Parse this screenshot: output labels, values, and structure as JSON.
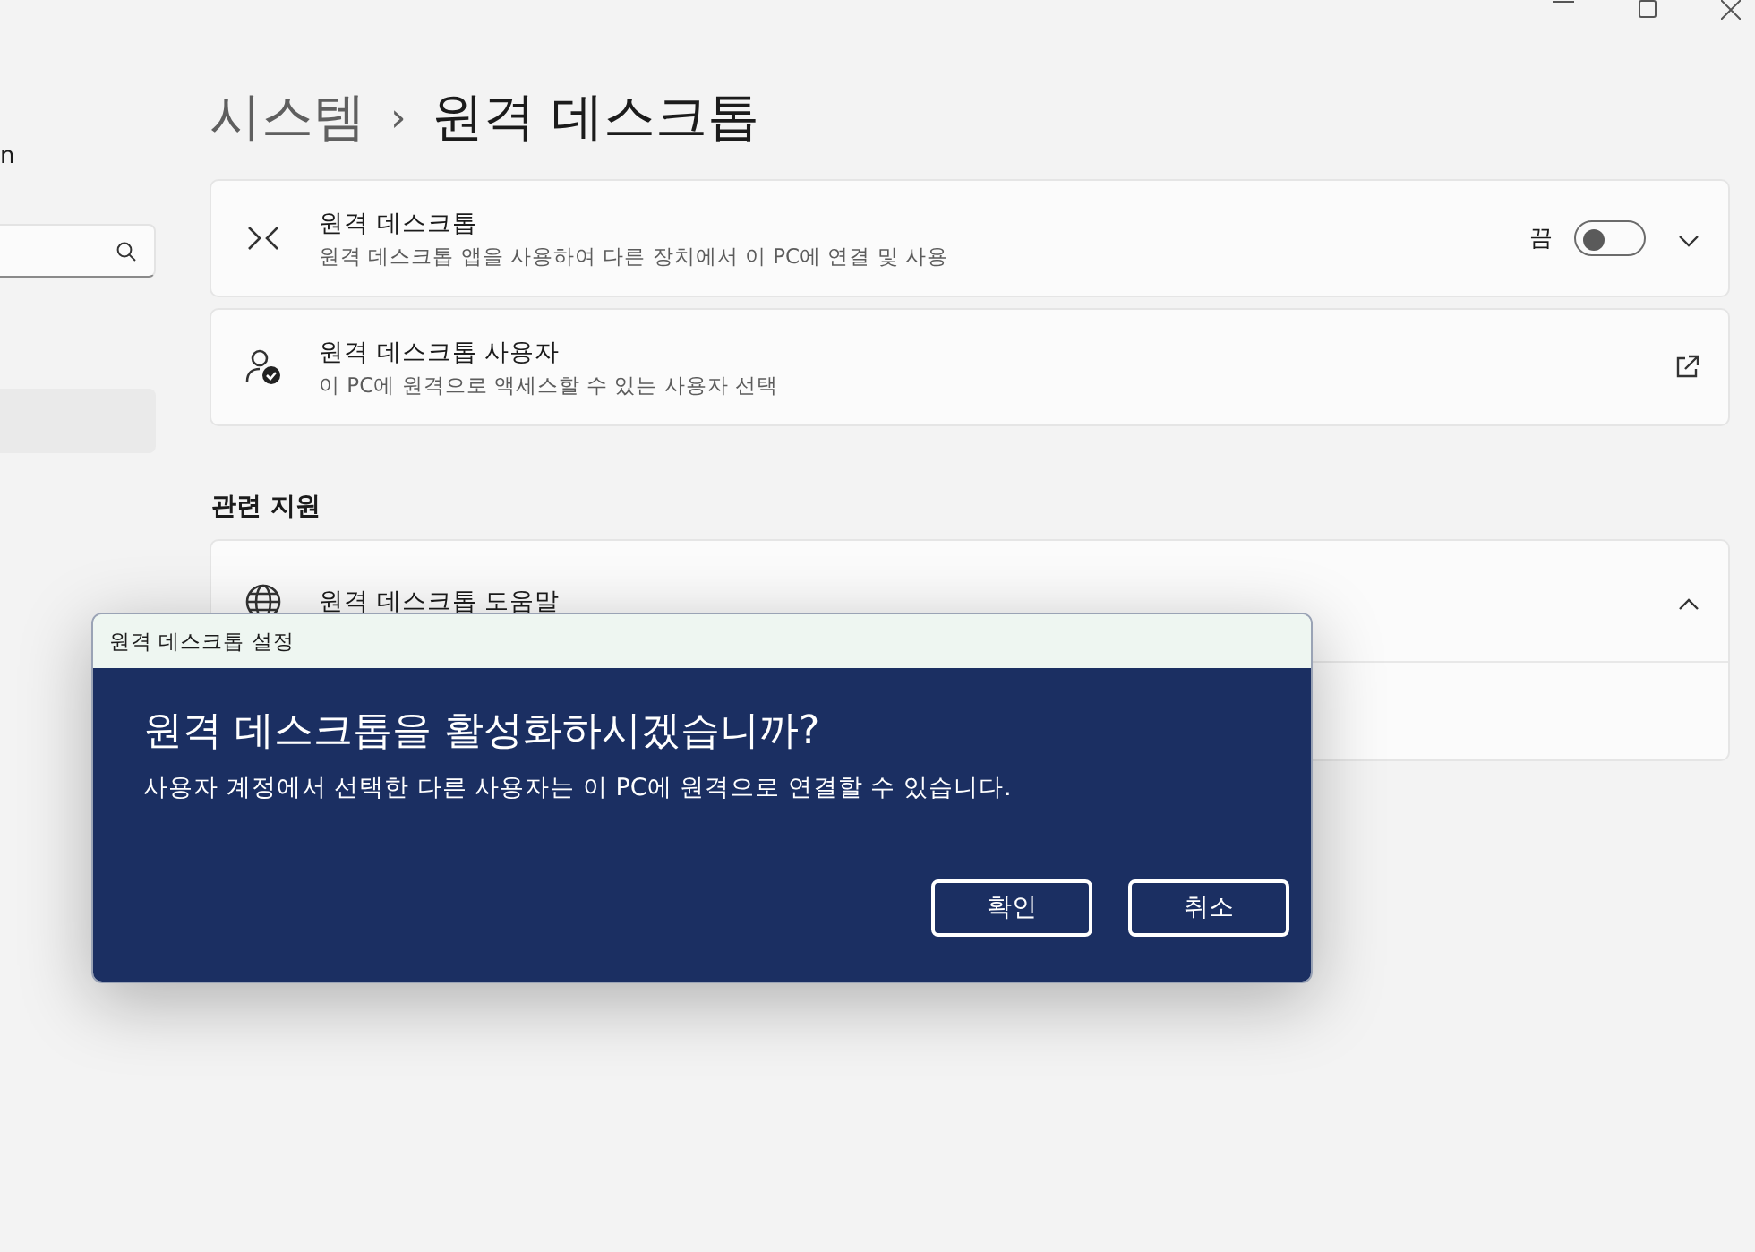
{
  "sidebar": {
    "user_name": "n"
  },
  "breadcrumb": {
    "parent": "시스템",
    "separator": "›",
    "current": "원격 데스크톱"
  },
  "settings": [
    {
      "kind": "toggle",
      "title": "원격 데스크톱",
      "description": "원격 데스크톱 앱을 사용하여 다른 장치에서 이 PC에 연결 및 사용",
      "state_label": "끔",
      "on": false,
      "expanded": false
    },
    {
      "kind": "link",
      "title": "원격 데스크톱 사용자",
      "description": "이 PC에 원격으로 액세스할 수 있는 사용자 선택"
    }
  ],
  "related": {
    "heading": "관련 지원",
    "items": [
      {
        "title": "원격 데스크톱 도움말",
        "expanded": true
      }
    ]
  },
  "dialog": {
    "title": "원격 데스크톱 설정",
    "heading": "원격 데스크톱을 활성화하시겠습니까?",
    "message": "사용자 계정에서 선택한 다른 사용자는 이 PC에 원격으로 연결할 수 있습니다.",
    "buttons": [
      "확인",
      "취소"
    ]
  }
}
